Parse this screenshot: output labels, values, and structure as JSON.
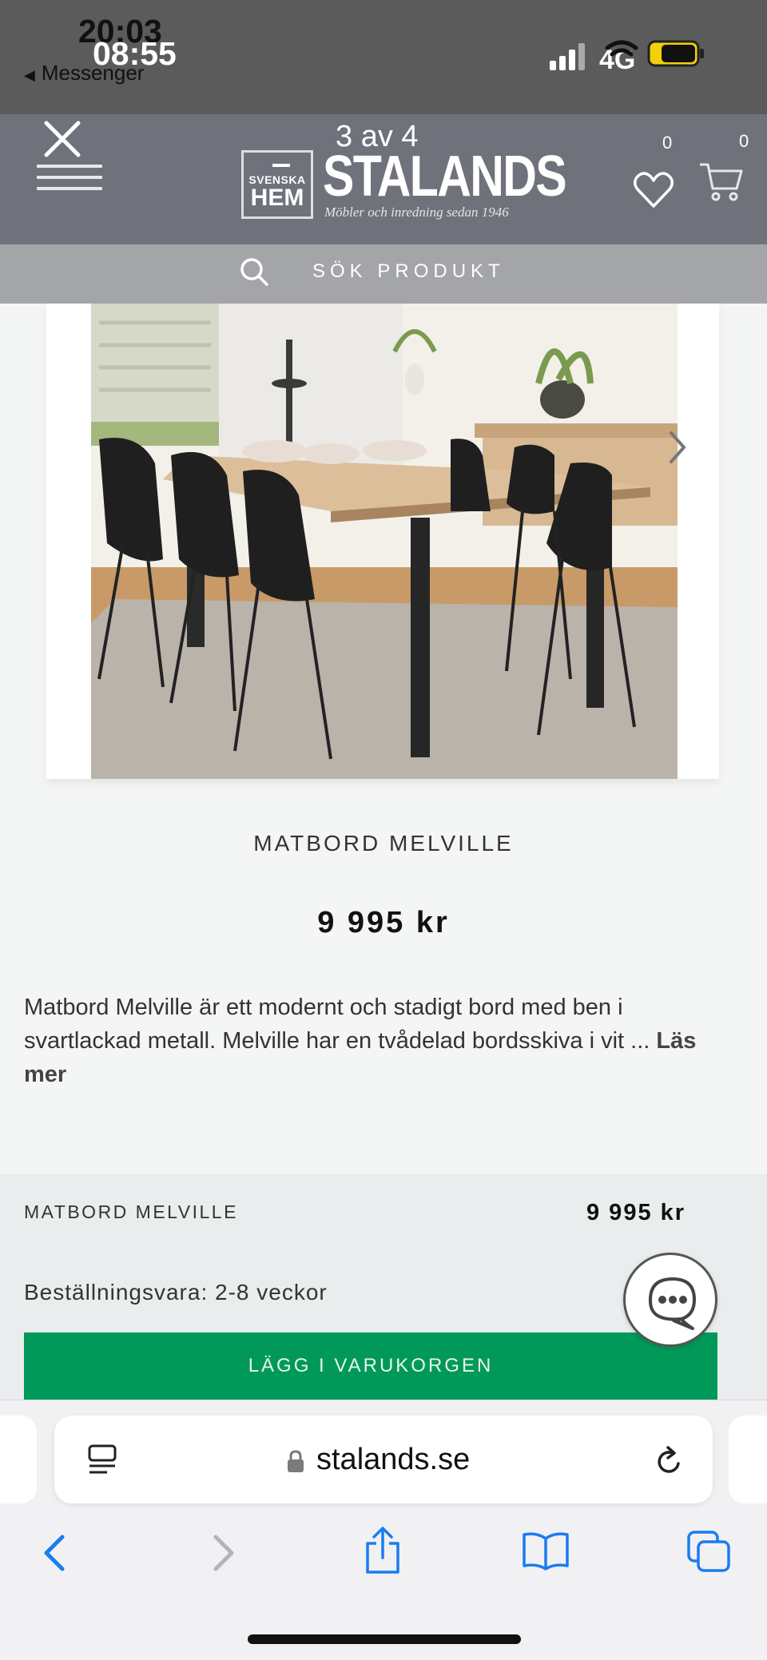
{
  "status_bar": {
    "time_primary": "20:03",
    "time_secondary": "08:55",
    "back_app": "Messenger",
    "network": "4G"
  },
  "viewer": {
    "counter": "3 av 4"
  },
  "header": {
    "logo_line1": "SVENSKA",
    "logo_line2": "HEM",
    "brand": "STALANDS",
    "tagline": "Möbler och inredning sedan 1946",
    "wishlist_count": "0",
    "cart_count": "0"
  },
  "search": {
    "label": "SÖK PRODUKT"
  },
  "product": {
    "title": "MATBORD MELVILLE",
    "price": "9 995 kr",
    "description": "Matbord Melville är ett modernt och stadigt bord med ben i svartlackad metall. Melville har en tvådelad bordsskiva i vit ...",
    "read_more": "Läs mer"
  },
  "buy_panel": {
    "name": "MATBORD MELVILLE",
    "price": "9 995 kr",
    "delivery": "Beställningsvara: 2-8 veckor",
    "add_to_cart": "LÄGG I VARUKORGEN"
  },
  "browser": {
    "url": "stalands.se"
  },
  "colors": {
    "header_bg": "#6f727b",
    "search_bg": "#a3a5a9",
    "cta_green": "#00995a",
    "panel_bg": "#e9edee",
    "ios_blue": "#1a7cf0"
  }
}
